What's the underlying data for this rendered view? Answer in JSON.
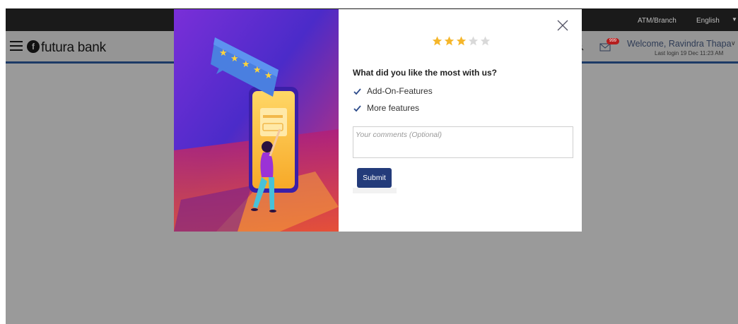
{
  "topbar": {
    "atm_label": "ATM/Branch",
    "language": "English"
  },
  "header": {
    "logo_text": "futura bank",
    "mail_badge": "999",
    "welcome": "Welcome, Ravindra Thapa",
    "last_login": "Last login 19 Dec 11:23 AM"
  },
  "feedback": {
    "rating": 3,
    "max_rating": 5,
    "star_filled_color": "#f5b62a",
    "star_empty_color": "#d9d9d9",
    "question": "What did you like the most with us?",
    "options": [
      {
        "label": "Add-On-Features",
        "checked": true
      },
      {
        "label": "More features",
        "checked": true
      }
    ],
    "comments_placeholder": "Your comments (Optional)",
    "submit_label": "Submit"
  },
  "colors": {
    "brand_navy": "#233b7a",
    "overlay_gray": "#9a9a9a"
  }
}
